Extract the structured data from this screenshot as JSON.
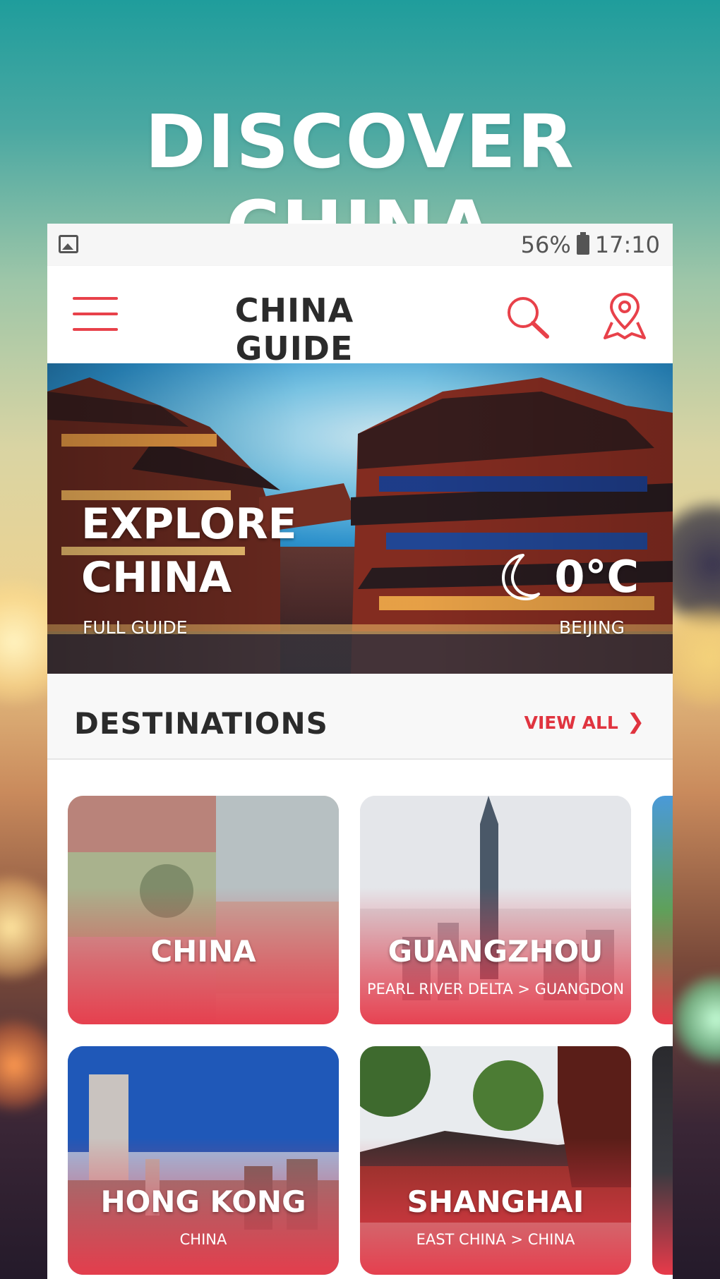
{
  "promo": {
    "headline": "DISCOVER CHINA"
  },
  "statusbar": {
    "battery": "56%",
    "time": "17:10",
    "icons": [
      "image-icon",
      "battery-icon"
    ]
  },
  "appbar": {
    "title": "CHINA GUIDE",
    "icons": [
      "menu-icon",
      "search-icon",
      "map-pin-icon"
    ],
    "accent_color": "#e8414a"
  },
  "hero": {
    "title_line1": "EXPLORE",
    "title_line2": "CHINA",
    "subtitle": "FULL GUIDE",
    "temperature": "0°C",
    "city": "BEIJING",
    "weather_icon": "moon-icon"
  },
  "destinations": {
    "section_title": "DESTINATIONS",
    "view_all_label": "VIEW ALL",
    "view_all_icon": "chevron-right-icon",
    "cards": [
      {
        "name": "CHINA",
        "path": ""
      },
      {
        "name": "GUANGZHOU",
        "path": "PEARL RIVER DELTA > GUANGDON"
      },
      {
        "name": "HONG KONG",
        "path": "CHINA"
      },
      {
        "name": "SHANGHAI",
        "path": "EAST CHINA > CHINA"
      }
    ],
    "card_gradient_color": "#e83a4a"
  }
}
